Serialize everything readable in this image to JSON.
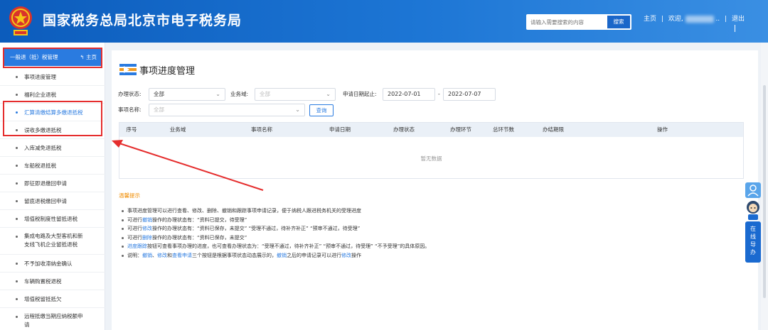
{
  "header": {
    "title": "国家税务总局北京市电子税务局",
    "search_placeholder": "请输入需要搜索的内容",
    "search_button": "搜索",
    "home_link": "主页",
    "welcome": "欢迎,",
    "user_suffix": "..",
    "logout": "退出",
    "divider": "|"
  },
  "sidebar": {
    "header_label": "一般退（抵）税管理",
    "header_home": "主页",
    "items": [
      {
        "label": "事项进度管理"
      },
      {
        "label": "福利企业退税"
      },
      {
        "label": "汇算清缴结算多缴退抵税"
      },
      {
        "label": "误收多缴退抵税"
      },
      {
        "label": "入库减免退抵税"
      },
      {
        "label": "车船税退抵税"
      },
      {
        "label": "即征即退缴回申请"
      },
      {
        "label": "留底退税缴回申请"
      },
      {
        "label": "增值税制度性留抵退税"
      },
      {
        "label": "集成电路及大型客机和新",
        "label2": "支线飞机企业留抵退税"
      },
      {
        "label": "不予加收滞纳金确认"
      },
      {
        "label": "车辆购置税退税"
      },
      {
        "label": "增值税留抵抵欠"
      },
      {
        "label": "远程抵缴当期应纳税额申",
        "label2": "请"
      }
    ]
  },
  "main": {
    "title": "事项进度管理",
    "filters": {
      "status_label": "办理状态:",
      "status_value": "全部",
      "domain_label": "业务域:",
      "domain_value": "全部",
      "date_label": "申请日期起止:",
      "date_start": "2022-07-01",
      "date_sep": "-",
      "date_end": "2022-07-07",
      "item_label": "事项名称:",
      "item_value": "全部",
      "query_button": "查询"
    },
    "table": {
      "columns": [
        "序号",
        "业务域",
        "事项名称",
        "申请日期",
        "办理状态",
        "办理环节",
        "总环节数",
        "办结期限",
        "操作"
      ],
      "empty_text": "暂无数据"
    },
    "tips_title": "温馨提示",
    "tips": [
      {
        "parts": [
          {
            "t": "事项进度管理可以进行查看、修改、删除、撤销和跟踪事项申请记录，便于纳税人跟进税务机关的受理进度"
          }
        ]
      },
      {
        "parts": [
          {
            "t": "可进行"
          },
          {
            "t": "撤销",
            "blue": true
          },
          {
            "t": "操作的办理状态有：“资料已提交，待受理”"
          }
        ]
      },
      {
        "parts": [
          {
            "t": "可进行"
          },
          {
            "t": "修改",
            "blue": true
          },
          {
            "t": "操作的办理状态有：“资料已保存，未提交”  “受理不通过，待补齐补正”  “预审不通过，待受理”"
          }
        ]
      },
      {
        "parts": [
          {
            "t": "可进行"
          },
          {
            "t": "删除",
            "blue": true
          },
          {
            "t": "操作的办理状态有：“资料已保存，未提交”"
          }
        ]
      },
      {
        "parts": [
          {
            "t": "进度跟踪",
            "blue": true
          },
          {
            "t": "按钮可查看事项办理的进度，也可查看办理状态为：“受理不通过，待补齐补正”  “预审不通过，待受理”  “不予受理”的具体原因。"
          }
        ]
      },
      {
        "parts": [
          {
            "t": "说明："
          },
          {
            "t": "撤销",
            "blue": true
          },
          {
            "t": "、"
          },
          {
            "t": "修改",
            "blue": true
          },
          {
            "t": "和"
          },
          {
            "t": "查看申请",
            "blue": true
          },
          {
            "t": "三个按钮是根据事项状态动态展示的，"
          },
          {
            "t": "撤销",
            "blue": true
          },
          {
            "t": "之后的申请记录可以进行"
          },
          {
            "t": "修改",
            "blue": true
          },
          {
            "t": "操作"
          }
        ]
      }
    ]
  },
  "float": {
    "guide_label": "在线导办"
  },
  "colors": {
    "header_blue": "#0c5cbc",
    "accent_blue": "#2a7be0",
    "annotation_red": "#e52d2d",
    "tips_orange": "#f08c00"
  }
}
